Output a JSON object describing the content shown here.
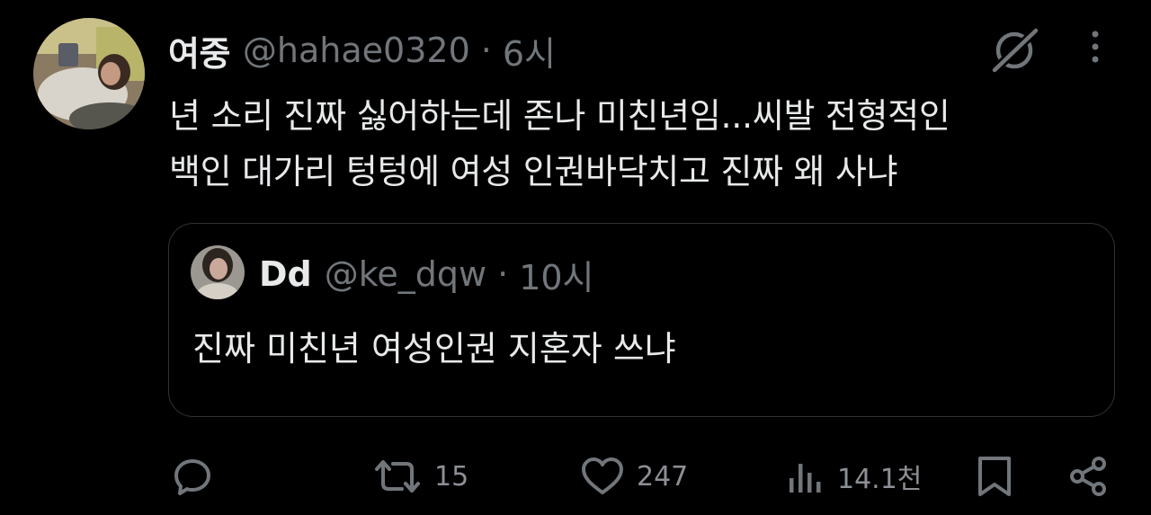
{
  "tweet": {
    "display_name": "여중",
    "handle": "@hahae0320",
    "separator": "·",
    "time": "6시",
    "text_line1": "년 소리 진짜 싫어하는데 존나 미친년임...씨발 전형적인",
    "text_line2": "백인 대가리 텅텅에 여성 인권바닥치고 진짜 왜 사냐"
  },
  "quote": {
    "display_name": "Dd",
    "handle": "@ke_dqw",
    "separator": "·",
    "time": "10시",
    "text": "진짜 미친년 여성인권 지혼자 쓰냐"
  },
  "actions": {
    "reply": {
      "icon": "reply-icon"
    },
    "retweet": {
      "icon": "retweet-icon",
      "count": "15"
    },
    "like": {
      "icon": "heart-icon",
      "count": "247"
    },
    "views": {
      "icon": "views-icon",
      "count": "14.1천"
    },
    "bookmark": {
      "icon": "bookmark-icon"
    },
    "share": {
      "icon": "share-icon"
    }
  },
  "colors": {
    "background": "#000000",
    "text_primary": "#e7e9ea",
    "text_secondary": "#71767b",
    "border": "#2f3336"
  }
}
